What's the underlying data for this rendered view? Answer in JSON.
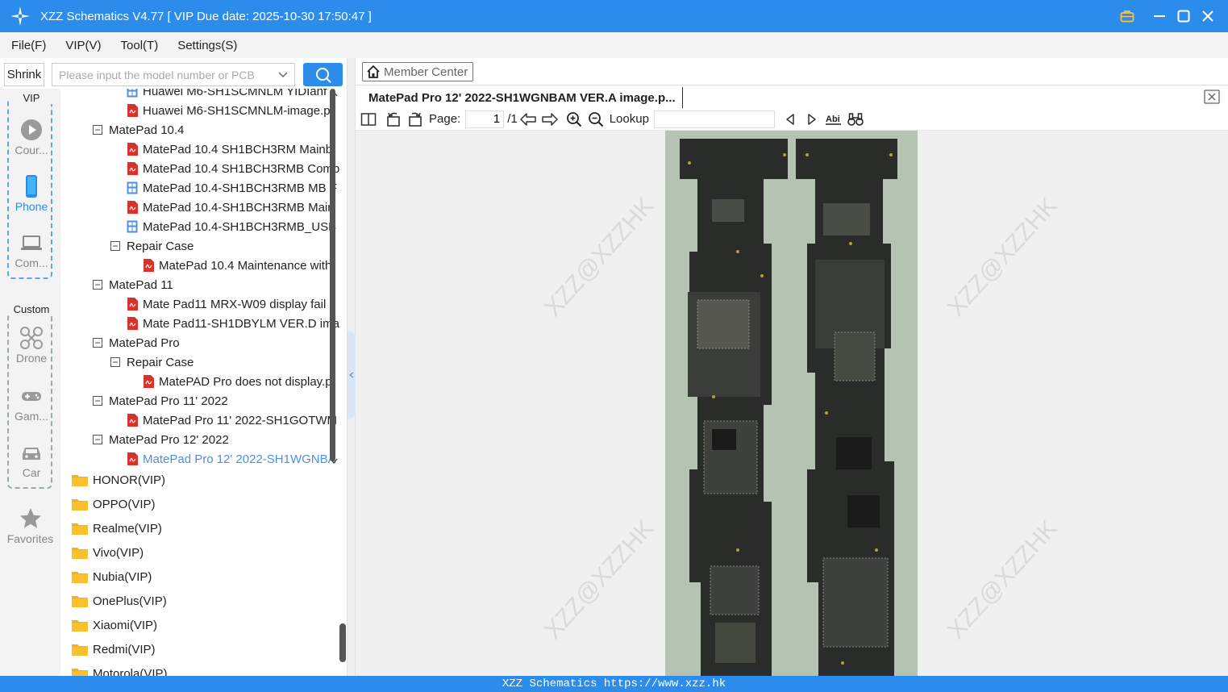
{
  "titlebar": {
    "title": "XZZ Schematics V4.77 [ VIP Due date: 2025-10-30 17:50:47 ]",
    "icons": [
      "app-logo-icon",
      "briefcase-icon",
      "minimize-icon",
      "maximize-icon",
      "close-icon"
    ],
    "color": "#2b8cec"
  },
  "menu": {
    "items": [
      {
        "label": "File(F)"
      },
      {
        "label": "VIP(V)"
      },
      {
        "label": "Tool(T)"
      },
      {
        "label": "Settings(S)"
      }
    ]
  },
  "search": {
    "shrink_label": "Shrink",
    "placeholder": "Please input the model number or PCB",
    "value": ""
  },
  "rail": {
    "vip_label": "VIP",
    "custom_label": "Custom",
    "vip_items": [
      {
        "label": "Cour...",
        "icon": "play-icon"
      },
      {
        "label": "Phone",
        "icon": "phone-icon",
        "active": true
      },
      {
        "label": "Com...",
        "icon": "laptop-icon"
      }
    ],
    "custom_items": [
      {
        "label": "Drone",
        "icon": "drone-icon"
      },
      {
        "label": "Gam...",
        "icon": "gamepad-icon"
      },
      {
        "label": "Car",
        "icon": "car-icon"
      }
    ],
    "favorites_label": "Favorites"
  },
  "tree": {
    "rows": [
      {
        "label": "Huawei M6-SH1SCMNLM YIDIanf",
        "type": "image",
        "level": 2
      },
      {
        "label": "Huawei M6-SH1SCMNLM-image.p",
        "type": "pdf",
        "level": 2
      },
      {
        "label": "MatePad 10.4",
        "type": "group",
        "level": 1
      },
      {
        "label": "MatePad 10.4 SH1BCH3RM Mainb",
        "type": "pdf",
        "level": 2
      },
      {
        "label": "MatePad 10.4 SH1BCH3RMB Comp",
        "type": "pdf",
        "level": 2
      },
      {
        "label": "MatePad 10.4-SH1BCH3RMB MB F",
        "type": "image",
        "level": 2
      },
      {
        "label": "MatePad 10.4-SH1BCH3RMB Main",
        "type": "pdf",
        "level": 2
      },
      {
        "label": "MatePad 10.4-SH1BCH3RMB_USB",
        "type": "image",
        "level": 2
      },
      {
        "label": "Repair Case",
        "type": "group",
        "level": 2
      },
      {
        "label": "MatePad 10.4 Maintenance with",
        "type": "pdf",
        "level": 3
      },
      {
        "label": "MatePad 11",
        "type": "group",
        "level": 1
      },
      {
        "label": "Mate Pad11 MRX-W09 display fail",
        "type": "pdf",
        "level": 2
      },
      {
        "label": "Mate Pad11-SH1DBYLM VER.D ima",
        "type": "pdf",
        "level": 2
      },
      {
        "label": "MatePad Pro",
        "type": "group",
        "level": 1
      },
      {
        "label": "Repair Case",
        "type": "group",
        "level": 2
      },
      {
        "label": "MatePAD Pro does not display.p",
        "type": "pdf",
        "level": 3
      },
      {
        "label": "MatePad Pro 11' 2022",
        "type": "group",
        "level": 1
      },
      {
        "label": "MatePad Pro 11' 2022-SH1GOTWM",
        "type": "pdf",
        "level": 2
      },
      {
        "label": "MatePad Pro 12' 2022",
        "type": "group",
        "level": 1
      },
      {
        "label": "MatePad Pro 12' 2022-SH1WGNBA",
        "type": "pdf",
        "level": 2,
        "selected": true
      }
    ],
    "folders": [
      {
        "label": "HONOR(VIP)"
      },
      {
        "label": "OPPO(VIP)"
      },
      {
        "label": "Realme(VIP)"
      },
      {
        "label": "Vivo(VIP)"
      },
      {
        "label": "Nubia(VIP)"
      },
      {
        "label": "OnePlus(VIP)"
      },
      {
        "label": "Xiaomi(VIP)"
      },
      {
        "label": "Redmi(VIP)"
      },
      {
        "label": "Motorola(VIP)"
      }
    ]
  },
  "viewer": {
    "member_center_label": "Member Center",
    "tab_title": "MatePad Pro 12' 2022-SH1WGNBAM VER.A image.p...",
    "page_label": "Page:",
    "page_value": "1",
    "page_total": "/1",
    "lookup_label": "Lookup",
    "lookup_value": "",
    "watermark": "XZZ@XZZHK"
  },
  "status": {
    "text": "XZZ Schematics https://www.xzz.hk"
  }
}
